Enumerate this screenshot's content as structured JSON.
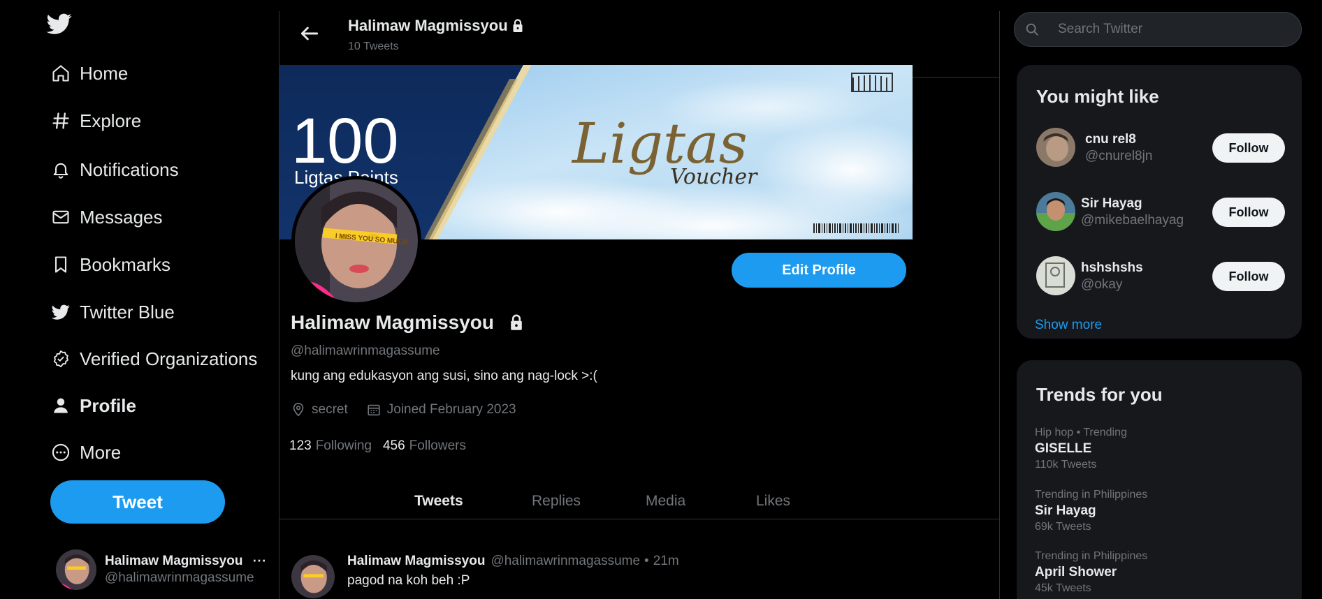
{
  "nav": {
    "logo": "twitter-bird-icon",
    "items": [
      {
        "label": "Home",
        "icon": "home-icon"
      },
      {
        "label": "Explore",
        "icon": "hashtag-icon"
      },
      {
        "label": "Notifications",
        "icon": "bell-icon"
      },
      {
        "label": "Messages",
        "icon": "envelope-icon"
      },
      {
        "label": "Bookmarks",
        "icon": "bookmark-icon"
      },
      {
        "label": "Twitter Blue",
        "icon": "twitter-bird-icon"
      },
      {
        "label": "Verified Organizations",
        "icon": "verified-badge-icon"
      },
      {
        "label": "Profile",
        "icon": "person-icon"
      },
      {
        "label": "More",
        "icon": "more-circle-icon"
      }
    ],
    "tweet_button": "Tweet",
    "account": {
      "name": "Halimaw Magmissyou",
      "handle": "@halimawrinmagassume",
      "more": "···"
    }
  },
  "header": {
    "name": "Halimaw Magmissyou",
    "tweet_count": "10 Tweets"
  },
  "banner": {
    "points_number": "100",
    "points_label": "Ligtas Points",
    "script_title": "Ligtas",
    "script_subtitle": "Voucher"
  },
  "avatar_overlay_text": "I MISS YOU SO MUCH",
  "profile": {
    "edit_button": "Edit Profile",
    "display_name": "Halimaw Magmissyou",
    "handle": "@halimawrinmagassume",
    "bio": "kung ang edukasyon ang susi, sino ang nag-lock >:(",
    "location": "secret",
    "joined": "Joined February 2023",
    "following_count": "123",
    "following_label": "Following",
    "followers_count": "456",
    "followers_label": "Followers"
  },
  "tabs": [
    "Tweets",
    "Replies",
    "Media",
    "Likes"
  ],
  "tweet": {
    "name": "Halimaw Magmissyou",
    "handle": "@halimawrinmagassume",
    "dot": "•",
    "time": "21m",
    "text": "pagod na koh beh :P"
  },
  "sidebar": {
    "search_placeholder": "Search Twitter",
    "who_to_follow": {
      "title": "You might like",
      "users": [
        {
          "name": "cnu rel8",
          "handle": "@cnurel8jn",
          "button": "Follow"
        },
        {
          "name": "Sir Hayag",
          "handle": "@mikebaelhayag",
          "button": "Follow"
        },
        {
          "name": "hshshshs",
          "handle": "@okay",
          "button": "Follow"
        }
      ],
      "show_more": "Show more"
    },
    "trends": {
      "title": "Trends for you",
      "items": [
        {
          "meta": "Hip hop • Trending",
          "name": "GISELLE",
          "count": "110k Tweets"
        },
        {
          "meta": "Trending in Philippines",
          "name": "Sir Hayag",
          "count": "69k Tweets"
        },
        {
          "meta": "Trending in Philippines",
          "name": "April Shower",
          "count": "45k Tweets"
        }
      ]
    }
  },
  "colors": {
    "accent": "#1d9bf0",
    "background": "#000000",
    "panel": "#16181c",
    "text": "#e7e9ea",
    "muted": "#71767b"
  }
}
